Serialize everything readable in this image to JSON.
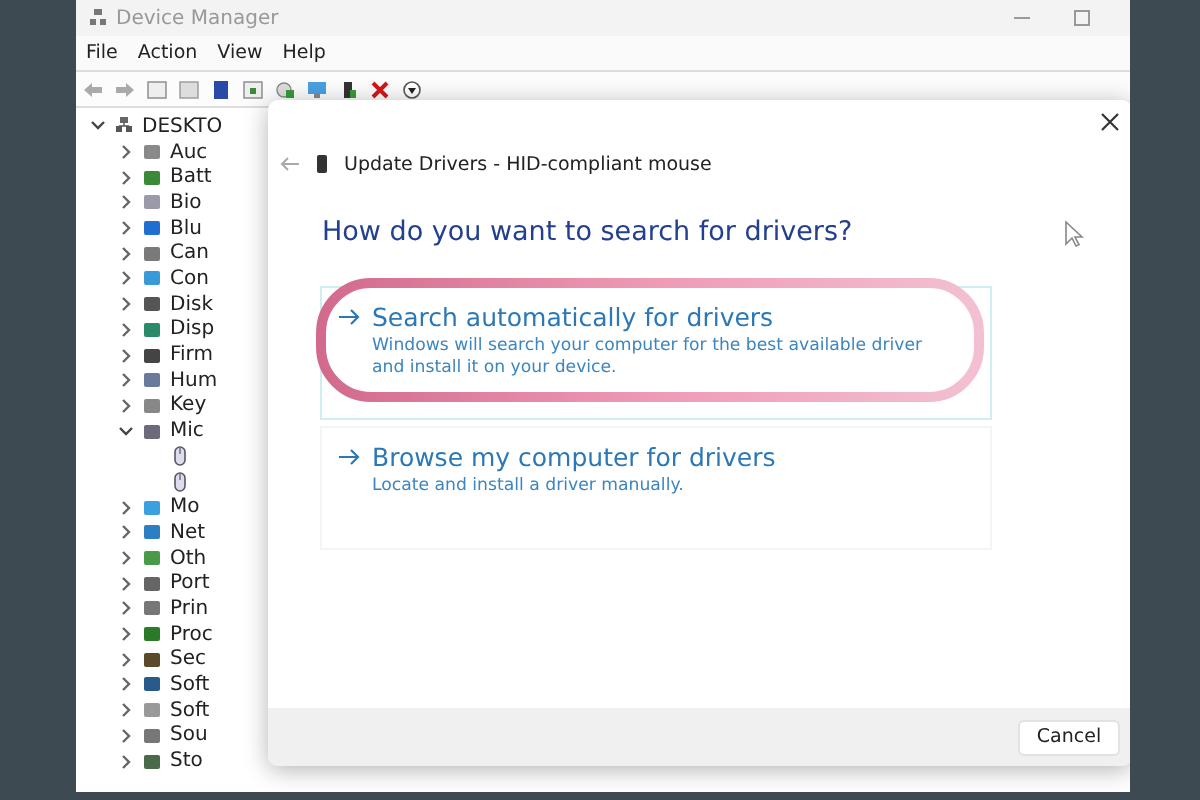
{
  "window": {
    "title": "Device Manager"
  },
  "menu": [
    "File",
    "Action",
    "View",
    "Help"
  ],
  "tree": [
    {
      "label": "DESKTO",
      "expanded": true,
      "children": [
        {
          "label": "Auc",
          "expanded": false
        },
        {
          "label": "Batt",
          "expanded": false
        },
        {
          "label": "Bio",
          "expanded": false
        },
        {
          "label": "Blu",
          "expanded": false
        },
        {
          "label": "Can",
          "expanded": false
        },
        {
          "label": "Con",
          "expanded": false
        },
        {
          "label": "Disk",
          "expanded": false
        },
        {
          "label": "Disp",
          "expanded": false
        },
        {
          "label": "Firm",
          "expanded": false
        },
        {
          "label": "Hum",
          "expanded": false
        },
        {
          "label": "Key",
          "expanded": false
        },
        {
          "label": "Mic",
          "expanded": true,
          "children": [
            {
              "kind": "mouse"
            },
            {
              "kind": "mouse"
            }
          ]
        },
        {
          "label": "Mo",
          "expanded": false
        },
        {
          "label": "Net",
          "expanded": false
        },
        {
          "label": "Oth",
          "expanded": false
        },
        {
          "label": "Port",
          "expanded": false
        },
        {
          "label": "Prin",
          "expanded": false
        },
        {
          "label": "Proc",
          "expanded": false
        },
        {
          "label": "Sec",
          "expanded": false
        },
        {
          "label": "Soft",
          "expanded": false
        },
        {
          "label": "Soft",
          "expanded": false
        },
        {
          "label": "Sou",
          "expanded": false
        },
        {
          "label": "Sto",
          "expanded": false
        }
      ]
    }
  ],
  "dialog": {
    "title": "Update Drivers - HID-compliant mouse",
    "heading": "How do you want to search for drivers?",
    "options": [
      {
        "title": "Search automatically for drivers",
        "description": "Windows will search your computer for the best available driver and install it on your device.",
        "highlighted": true
      },
      {
        "title": "Browse my computer for drivers",
        "description": "Locate and install a driver manually.",
        "highlighted": false
      }
    ],
    "cancel": "Cancel"
  }
}
